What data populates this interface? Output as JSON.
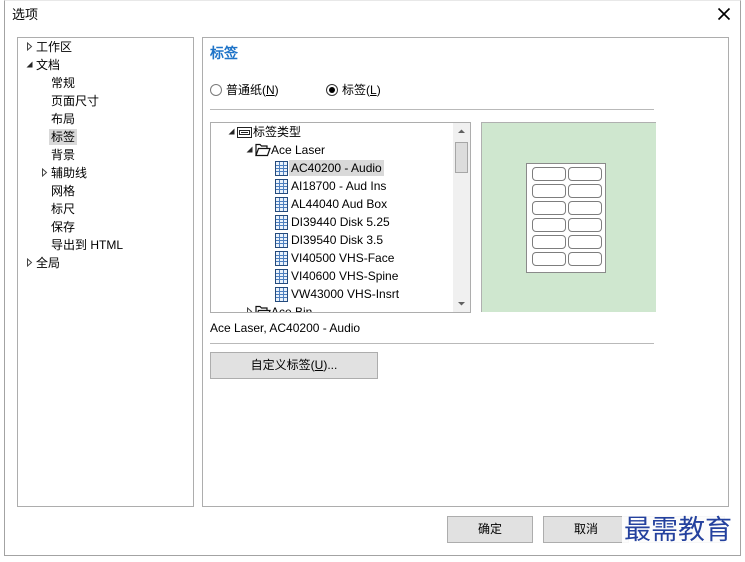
{
  "window": {
    "title": "选项"
  },
  "icons": {
    "close": "close-icon",
    "tree_root": "label-type-icon",
    "group_folder": "open-folder-icon",
    "label_item": "label-sheet-icon",
    "scroll_up": "scroll-up-arrow-icon",
    "scroll_down": "scroll-down-arrow-icon"
  },
  "colors": {
    "accent": "#1f74c8",
    "selection": "#d9d9d9",
    "preview_background": "#cfe7cf",
    "watermark": "#24419e"
  },
  "nav_tree": {
    "items": [
      {
        "label": "工作区",
        "expanded": false
      },
      {
        "label": "文档",
        "expanded": true
      },
      {
        "label": "常规"
      },
      {
        "label": "页面尺寸"
      },
      {
        "label": "布局"
      },
      {
        "label": "标签",
        "selected": true
      },
      {
        "label": "背景"
      },
      {
        "label": "辅助线",
        "expanded": false
      },
      {
        "label": "网格"
      },
      {
        "label": "标尺"
      },
      {
        "label": "保存"
      },
      {
        "label": "导出到 HTML"
      },
      {
        "label": "全局",
        "expanded": false
      }
    ]
  },
  "label_page": {
    "heading": "标签",
    "paper_type": {
      "options": [
        {
          "label": "普通纸(N)",
          "checked": false
        },
        {
          "label": "标签(L)",
          "checked": true
        }
      ]
    },
    "label_tree": {
      "root": {
        "label": "标签类型",
        "expanded": true
      },
      "groups": [
        {
          "name": "Ace Laser",
          "expanded": true,
          "items": [
            {
              "label": "AC40200 - Audio",
              "selected": true
            },
            {
              "label": "AI18700 - Aud Ins"
            },
            {
              "label": "AL44040 Aud Box"
            },
            {
              "label": "DI39440 Disk 5.25"
            },
            {
              "label": "DI39540 Disk 3.5"
            },
            {
              "label": "VI40500 VHS-Face"
            },
            {
              "label": "VI40600 VHS-Spine"
            },
            {
              "label": "VW43000 VHS-Insrt"
            }
          ]
        },
        {
          "name": "Ace Bin",
          "expanded": false
        }
      ]
    },
    "preview": {
      "columns": 2,
      "rows": 6
    },
    "selection_text": "Ace Laser, AC40200 - Audio",
    "custom_label_button": "自定义标签(U)..."
  },
  "footer": {
    "ok": "确定",
    "cancel": "取消"
  },
  "watermark": "最需教育"
}
